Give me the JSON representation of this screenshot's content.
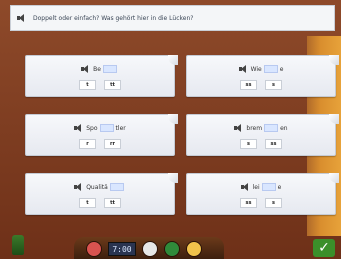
{
  "instruction": "Doppelt oder einfach? Was gehört hier in die Lücken?",
  "panels": [
    {
      "prefix": "Be",
      "suffix": "",
      "options": [
        "t",
        "tt"
      ]
    },
    {
      "prefix": "Wie",
      "suffix": "e",
      "options": [
        "ss",
        "s"
      ]
    },
    {
      "prefix": "Spo",
      "suffix": "tler",
      "options": [
        "r",
        "rr"
      ]
    },
    {
      "prefix": "brem",
      "suffix": "en",
      "options": [
        "s",
        "ss"
      ]
    },
    {
      "prefix": "Qualitä",
      "suffix": "",
      "options": [
        "t",
        "tt"
      ]
    },
    {
      "prefix": "lei",
      "suffix": "e",
      "options": [
        "ss",
        "s"
      ]
    }
  ],
  "toolbar": {
    "clock": "7:00"
  },
  "icons": {
    "speaker": "speaker-icon",
    "bottle": "bottle-icon",
    "clock": "clock-display",
    "check": "check-icon"
  },
  "colors": {
    "background": "#7a3a22",
    "panel_gap": "#d9e6ff",
    "check": "#3b8f2a"
  }
}
